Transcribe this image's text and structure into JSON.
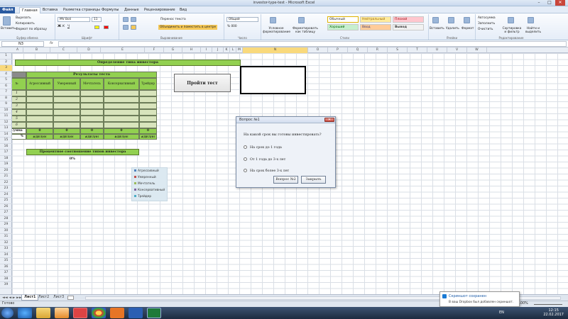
{
  "window": {
    "title": "investor-type-test - Microsoft Excel",
    "min": "–",
    "max": "□",
    "close": "✕"
  },
  "tabs": [
    "Файл",
    "Главная",
    "Вставка",
    "Разметка страницы",
    "Формулы",
    "Данные",
    "Рецензирование",
    "Вид"
  ],
  "ribbon": {
    "clipboard": {
      "label": "Буфер обмена",
      "paste": "Вставить",
      "cut": "Вырезать",
      "copy": "Копировать",
      "format_painter": "Формат по образцу"
    },
    "font": {
      "label": "Шрифт",
      "family": "MV Boli",
      "size": "11"
    },
    "alignment": {
      "label": "Выравнивание",
      "wrap": "Перенос текста",
      "merge": "Объединить и поместить в центре"
    },
    "number": {
      "label": "Число",
      "format": "Общий"
    },
    "cond": "Условное форматирование",
    "asTable": "Форматировать как таблицу",
    "styles": {
      "label": "Стили",
      "s1": "Обычный",
      "s2": "Нейтральный",
      "s3": "Плохой",
      "s4": "Хороший",
      "s5": "Ввод",
      "s6": "Вывод"
    },
    "cells": {
      "label": "Ячейки",
      "insert": "Вставить",
      "delete": "Удалить",
      "format": "Формат"
    },
    "editing": {
      "label": "Редактирование",
      "autosum": "Автосумма",
      "fill": "Заполнить",
      "clear": "Очистить",
      "sort": "Сортировка и фильтр",
      "find": "Найти и выделить"
    }
  },
  "formula": {
    "cell": "N3",
    "fx": "fx",
    "value": ""
  },
  "columns": [
    "A",
    "B",
    "C",
    "D",
    "E",
    "F",
    "G",
    "H",
    "I",
    "J",
    "K",
    "L",
    "M",
    "N",
    "O",
    "P",
    "Q",
    "R",
    "S",
    "T",
    "U",
    "V",
    "W"
  ],
  "rows": [
    "1",
    "2",
    "3",
    "4",
    "5",
    "6",
    "7",
    "8",
    "9",
    "10",
    "11",
    "12",
    "13",
    "14",
    "15",
    "16",
    "17",
    "18",
    "19",
    "20",
    "21",
    "22",
    "23",
    "24",
    "25",
    "26",
    "27",
    "28",
    "29",
    "30",
    "31",
    "32",
    "33",
    "34",
    "35",
    "36",
    "37",
    "38",
    "39"
  ],
  "sheet": {
    "title": "Определение типа инвестора",
    "results": "Результаты теста",
    "headers": [
      "№",
      "Агрессивный",
      "Умеренный",
      "Мечтатель",
      "Консервативный",
      "Трейдер"
    ],
    "nums": [
      "1",
      "2",
      "3",
      "4",
      "5",
      "6"
    ],
    "sum_label": "Сумма",
    "sums": [
      "0",
      "0",
      "0",
      "0",
      "0"
    ],
    "pct_label": "%",
    "pcts": [
      "#ДЕЛ/0!",
      "#ДЕЛ/0!",
      "#ДЕЛ/0!",
      "#ДЕЛ/0!",
      "#ДЕЛ/0!"
    ],
    "ratio_title": "Процентное соотношение типов инвестора",
    "ratio_value": "0%",
    "test_button": "Пройти тест",
    "legend": [
      "Агрессивный",
      "Умеренный",
      "Мечтатель",
      "Консервативный",
      "Трейдер"
    ],
    "legend_colors": [
      "#4f81bd",
      "#c0504d",
      "#9bbb59",
      "#8064a2",
      "#4bacc6"
    ]
  },
  "dialog": {
    "title": "Вопрос №1",
    "close": "✕",
    "question": "На какой срок вы готовы инвестировать?",
    "options": [
      "На срок до 1 года",
      "От 1 года до 3-х лет",
      "На срок более 3-х лет"
    ],
    "next": "Вопрос №2",
    "close_btn": "Закрыть"
  },
  "sheet_tabs": [
    "Лист1",
    "Лист2",
    "Лист3"
  ],
  "status": "Готово",
  "zoom": "100%",
  "toast": {
    "title": "Скриншот сохранен",
    "body": "В ваш Dropbox был добавлен скриншот."
  },
  "tray": {
    "lang": "EN",
    "time": "12:15",
    "date": "22.02.2017"
  }
}
